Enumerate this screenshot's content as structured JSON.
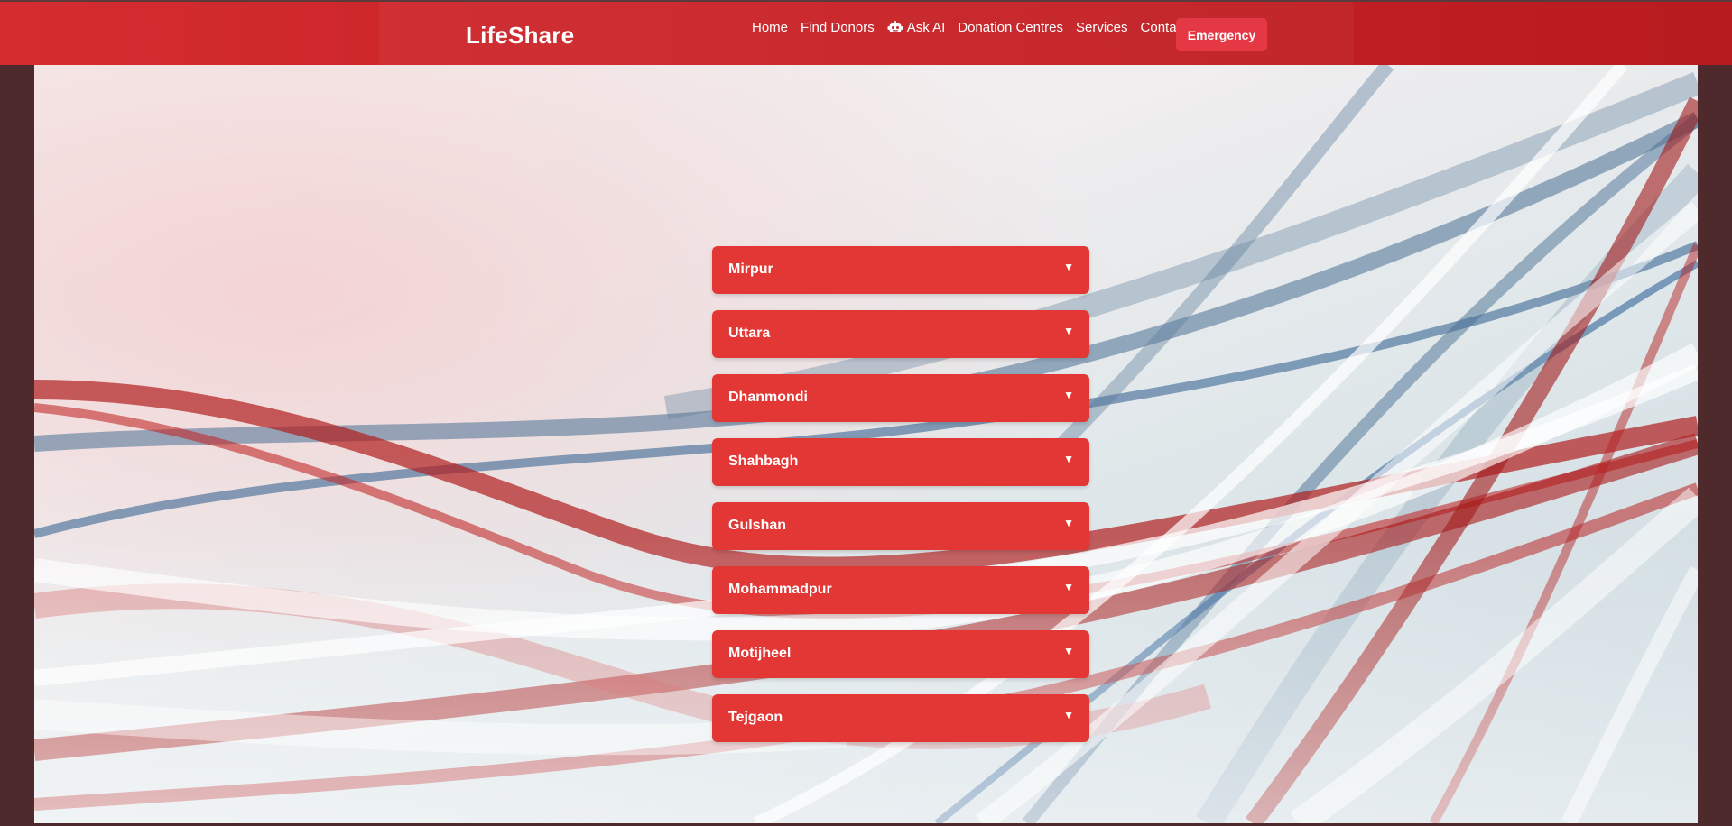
{
  "header": {
    "brand": "LifeShare",
    "nav": [
      {
        "label": "Home"
      },
      {
        "label": "Find Donors"
      },
      {
        "label": "Ask AI",
        "icon": "robot-icon"
      },
      {
        "label": "Donation Centres"
      },
      {
        "label": "Services"
      },
      {
        "label": "Contact"
      }
    ],
    "emergency_label": "Emergency"
  },
  "areas": [
    {
      "label": "Mirpur"
    },
    {
      "label": "Uttara"
    },
    {
      "label": "Dhanmondi"
    },
    {
      "label": "Shahbagh"
    },
    {
      "label": "Gulshan"
    },
    {
      "label": "Mohammadpur"
    },
    {
      "label": "Motijheel"
    },
    {
      "label": "Tejgaon"
    }
  ],
  "caret": "▼",
  "colors": {
    "header": "#c82226",
    "accordion": "#e23734",
    "emergency": "#e53845",
    "frame": "#4e2a2c"
  }
}
